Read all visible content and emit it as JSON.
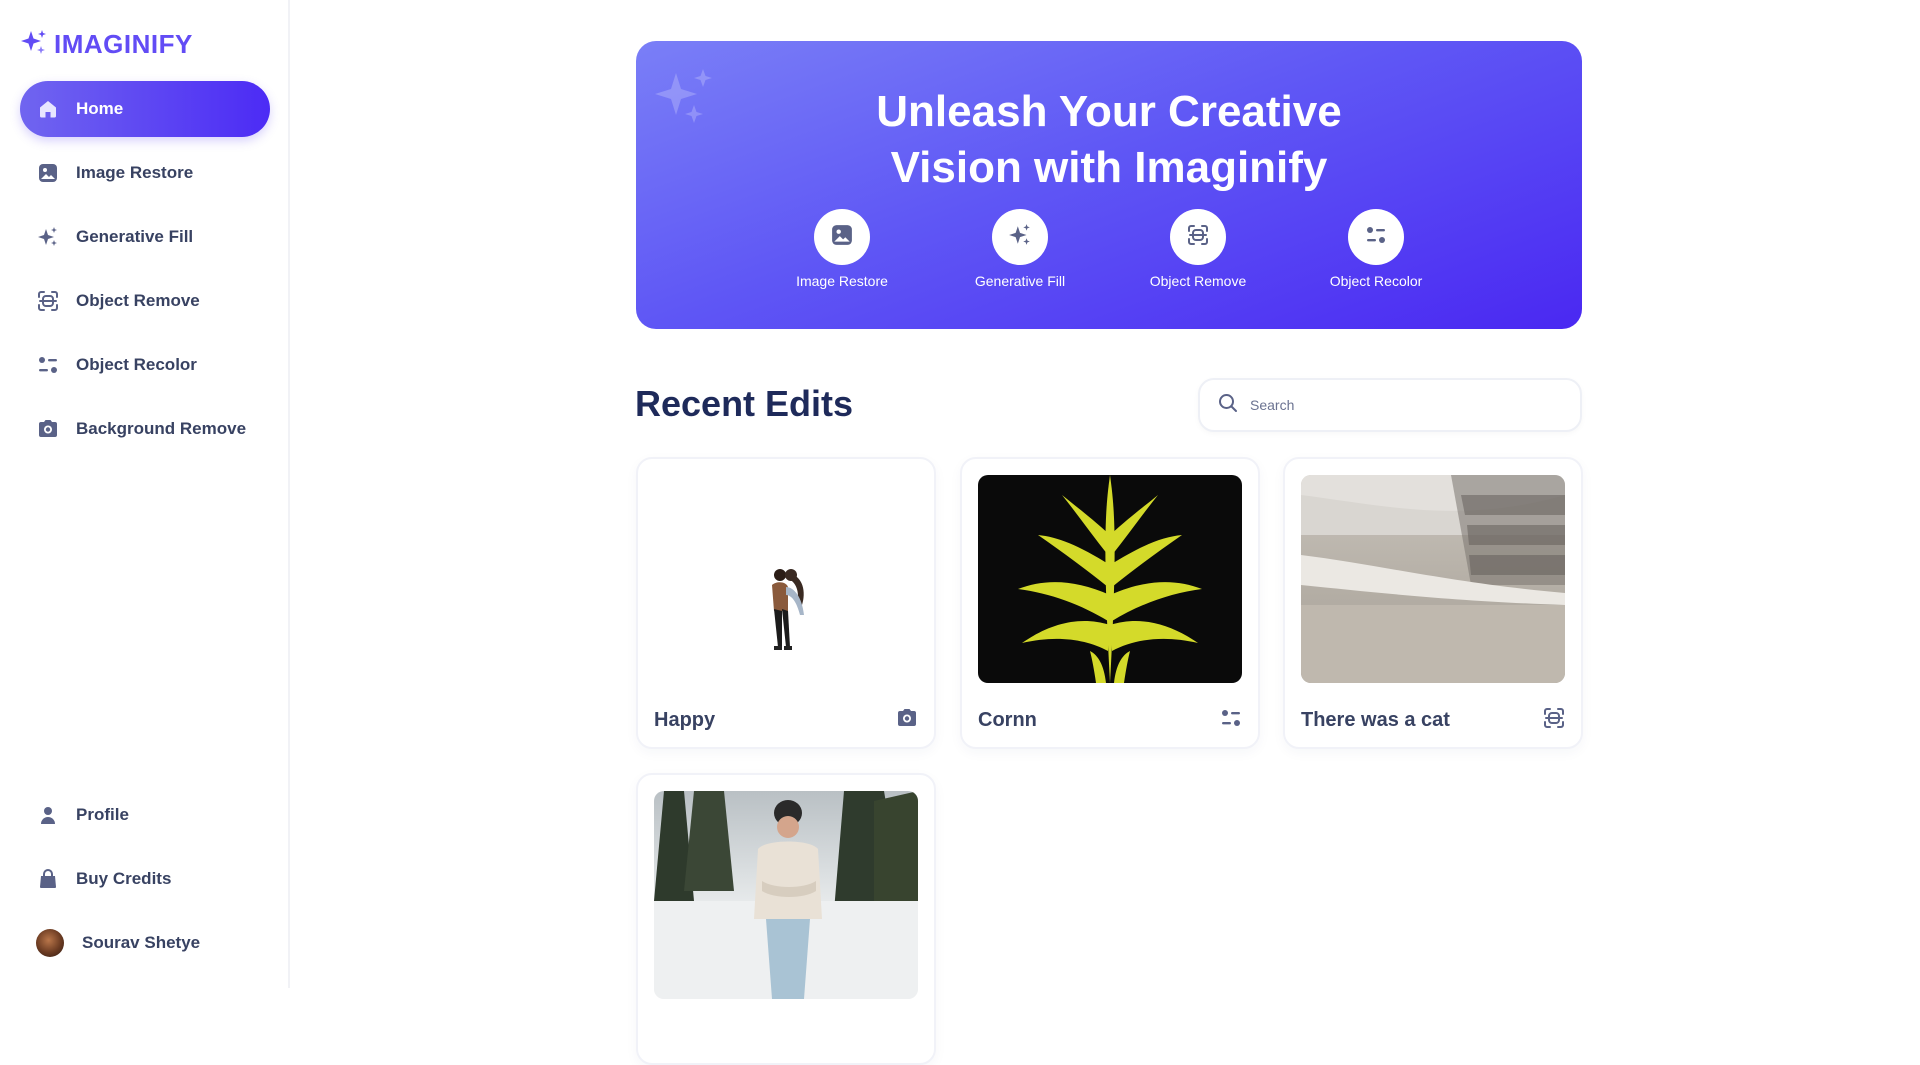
{
  "app": {
    "name": "IMAGINIFY"
  },
  "sidebar": {
    "items": [
      {
        "label": "Home",
        "icon": "home-icon",
        "active": true
      },
      {
        "label": "Image Restore",
        "icon": "image-icon"
      },
      {
        "label": "Generative Fill",
        "icon": "sparkles-icon"
      },
      {
        "label": "Object Remove",
        "icon": "scan-icon"
      },
      {
        "label": "Object Recolor",
        "icon": "filter-icon"
      },
      {
        "label": "Background Remove",
        "icon": "camera-icon"
      }
    ],
    "bottom": [
      {
        "label": "Profile",
        "icon": "profile-icon"
      },
      {
        "label": "Buy Credits",
        "icon": "bag-icon"
      }
    ],
    "user": {
      "name": "Sourav Shetye"
    }
  },
  "banner": {
    "title_line1": "Unleash Your Creative",
    "title_line2": "Vision with Imaginify",
    "tools": [
      {
        "label": "Image Restore",
        "icon": "image-icon"
      },
      {
        "label": "Generative Fill",
        "icon": "sparkles-icon"
      },
      {
        "label": "Object Remove",
        "icon": "scan-icon"
      },
      {
        "label": "Object Recolor",
        "icon": "filter-icon"
      }
    ]
  },
  "recent": {
    "title": "Recent Edits",
    "search_placeholder": "Search",
    "cards": [
      {
        "title": "Happy",
        "icon": "camera-icon"
      },
      {
        "title": "Cornn",
        "icon": "filter-icon"
      },
      {
        "title": "There was a cat",
        "icon": "scan-icon"
      },
      {
        "title": "",
        "icon": ""
      }
    ]
  },
  "colors": {
    "accent": "#624cf5",
    "accent_dark": "#4c2bf5",
    "text": "#384262",
    "heading": "#1e2a5a"
  }
}
